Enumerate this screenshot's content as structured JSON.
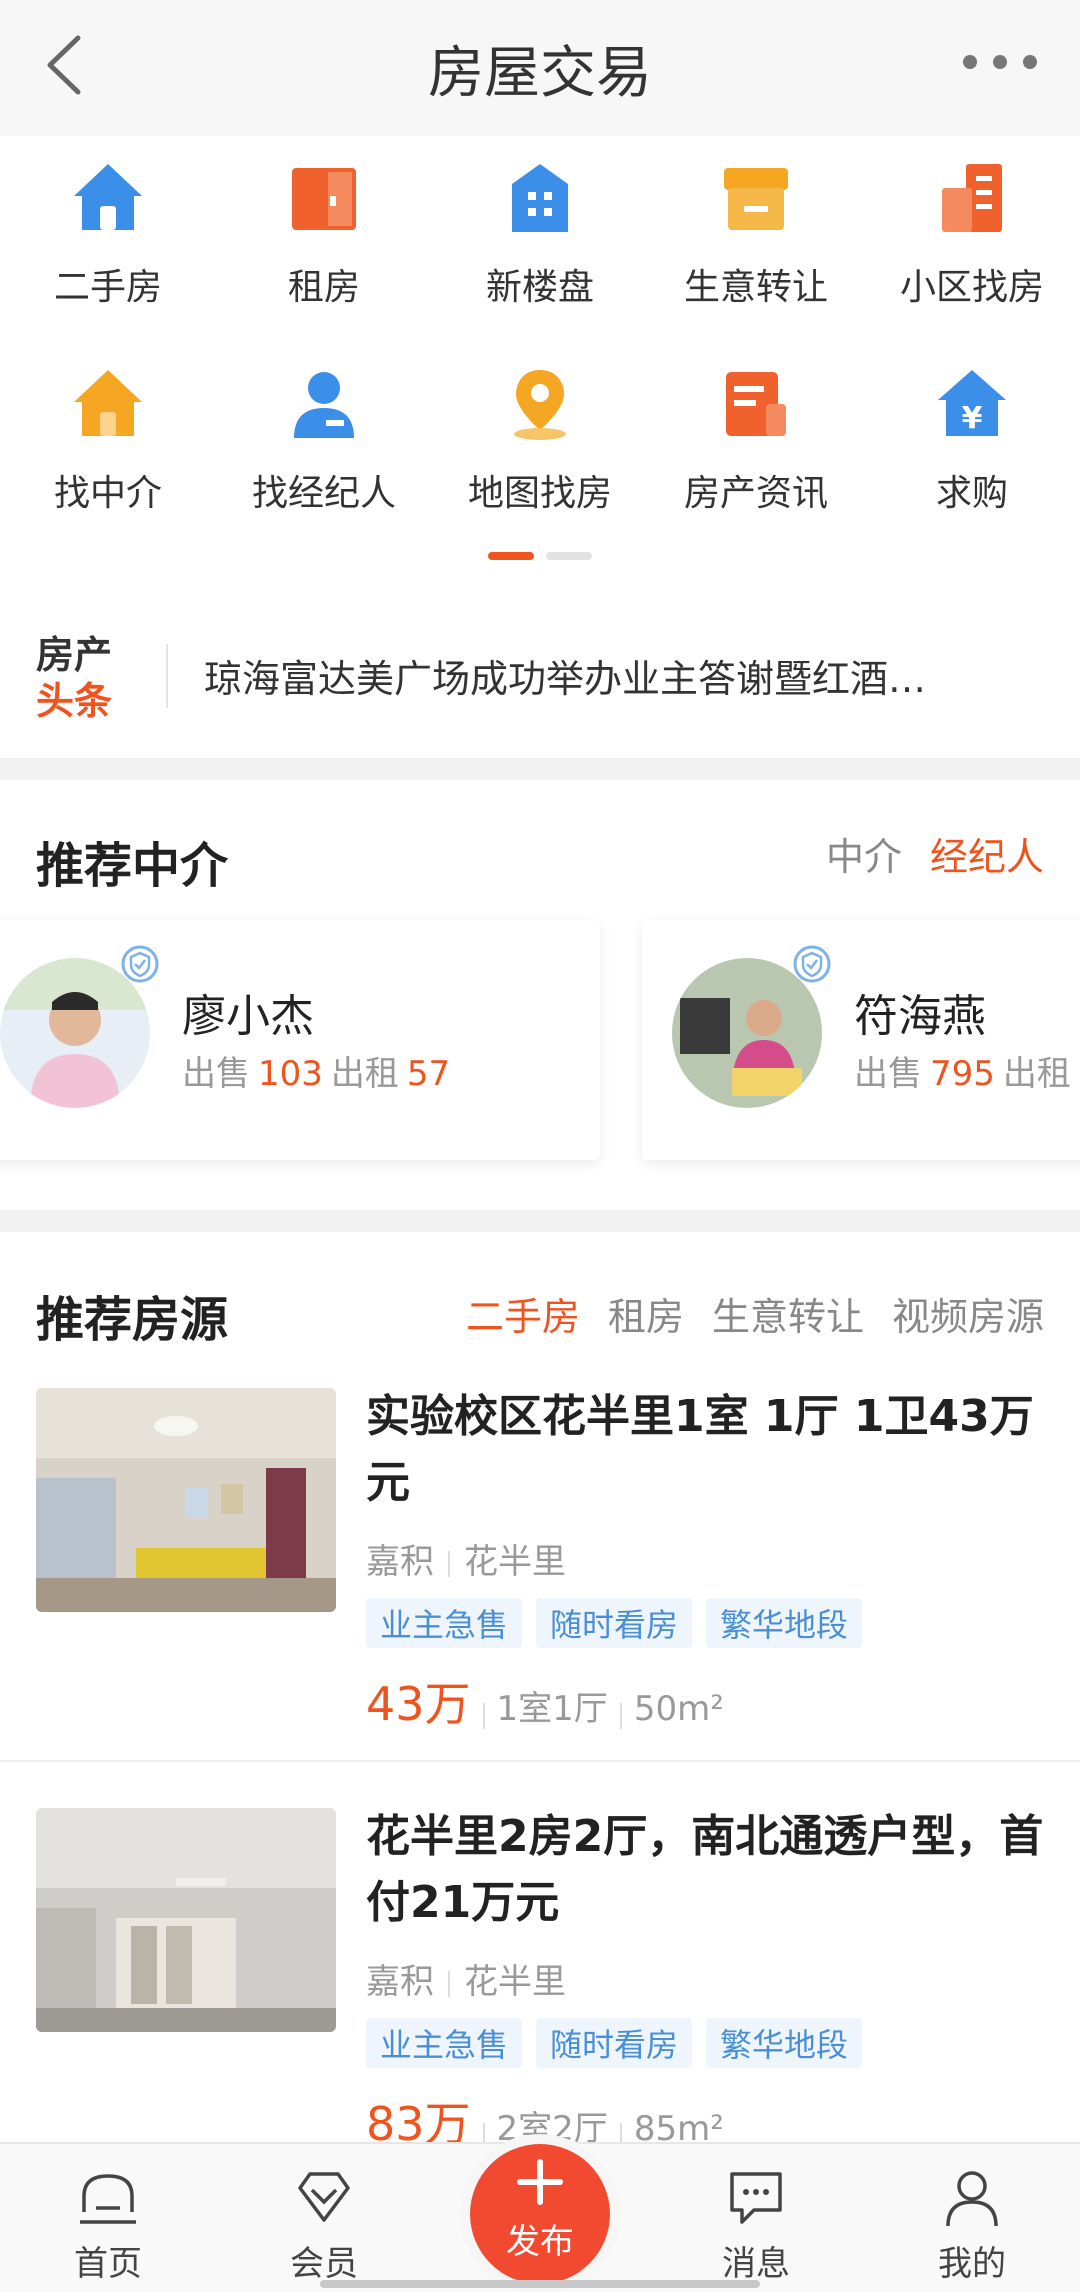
{
  "header": {
    "title": "房屋交易"
  },
  "categories": [
    {
      "label": "二手房",
      "icon": "house-icon",
      "color": "#3b8fe8"
    },
    {
      "label": "租房",
      "icon": "door-icon",
      "color": "#f0612e"
    },
    {
      "label": "新楼盘",
      "icon": "building-icon",
      "color": "#3b8fe8"
    },
    {
      "label": "生意转让",
      "icon": "shop-icon",
      "color": "#f5a623"
    },
    {
      "label": "小区找房",
      "icon": "apartment-icon",
      "color": "#f0612e"
    },
    {
      "label": "找中介",
      "icon": "agency-house-icon",
      "color": "#f5a623"
    },
    {
      "label": "找经纪人",
      "icon": "agent-person-icon",
      "color": "#3b8fe8"
    },
    {
      "label": "地图找房",
      "icon": "map-pin-icon",
      "color": "#f5a623"
    },
    {
      "label": "房产资讯",
      "icon": "news-doc-icon",
      "color": "#f0612e"
    },
    {
      "label": "求购",
      "icon": "yuan-house-icon",
      "color": "#3b8fe8"
    }
  ],
  "news": {
    "logo_line1": "房产",
    "logo_line2": "头条",
    "headline": "琼海富达美广场成功举办业主答谢暨红酒…"
  },
  "recommend_agents": {
    "title": "推荐中介",
    "tabs": [
      "中介",
      "经纪人"
    ],
    "active_tab": "经纪人",
    "sale_label": "出售",
    "rent_label": "出租",
    "agents": [
      {
        "name": "廖小杰",
        "sale": "103",
        "rent": "57"
      },
      {
        "name": "符海燕",
        "sale": "795",
        "rent": ""
      }
    ]
  },
  "recommend_listings": {
    "title": "推荐房源",
    "tabs": [
      "二手房",
      "租房",
      "生意转让",
      "视频房源"
    ],
    "active_tab": "二手房",
    "items": [
      {
        "title": "实验校区花半里1室 1厅 1卫43万元",
        "district": "嘉积",
        "community": "花半里",
        "tags": [
          "业主急售",
          "随时看房",
          "繁华地段"
        ],
        "price": "43万",
        "layout": "1室1厅",
        "area": "50m²"
      },
      {
        "title": "花半里2房2厅，南北通透户型，首付21万元",
        "district": "嘉积",
        "community": "花半里",
        "tags": [
          "业主急售",
          "随时看房",
          "繁华地段"
        ],
        "price": "83万",
        "layout": "2室2厅",
        "area": "85m²"
      }
    ]
  },
  "bottom_nav": {
    "home": "首页",
    "member": "会员",
    "publish": "发布",
    "messages": "消息",
    "mine": "我的"
  },
  "colors": {
    "accent": "#f0541e",
    "tag_text": "#4a8fd6",
    "publish": "#f24a30"
  }
}
